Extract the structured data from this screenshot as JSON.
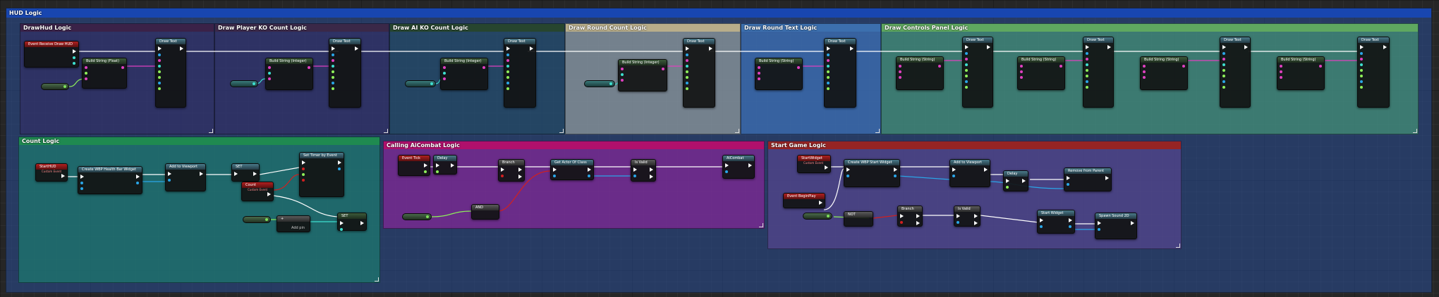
{
  "hud_logic": {
    "title": "HUD Logic"
  },
  "comments": [
    {
      "id": "drawhud",
      "title": "DrawHud Logic",
      "color": "#3a2248"
    },
    {
      "id": "player-ko",
      "title": "Draw Player KO Count Logic",
      "color": "#3a2848"
    },
    {
      "id": "ai-ko",
      "title": "Draw AI KO Count Logic",
      "color": "#27452f"
    },
    {
      "id": "round-count",
      "title": "Draw Round Count Logic",
      "color": "#b8ad8a"
    },
    {
      "id": "round-text",
      "title": "Draw Round Text Logic",
      "color": "#3c6fae"
    },
    {
      "id": "controls",
      "title": "Draw Controls Panel Logic",
      "color": "#5fa860"
    },
    {
      "id": "count",
      "title": "Count Logic",
      "color": "#1f8a50"
    },
    {
      "id": "aicombat",
      "title": "Calling AiCombat Logic",
      "color": "#b0106c"
    },
    {
      "id": "startgame",
      "title": "Start Game Logic",
      "color": "#962424"
    }
  ],
  "nodes": {
    "event_receive_draw_hud": "Event Receive Draw HUD",
    "draw_text": "Draw Text",
    "target_is_hud": "Target is HUD",
    "build_string_float": "Build String (Float)",
    "build_string_integer": "Build String (Integer)",
    "build_string_string": "Build String (String)",
    "start_hud": "StartHUD",
    "custom_event": "Custom Event",
    "create_wbp_health_bar": "Create WBP Health Bar Widget",
    "add_to_viewport": "Add to Viewport",
    "set": "SET",
    "count": "Count",
    "set_timer_by_event": "Set Timer by Event",
    "add_pin": "Add pin",
    "event_tick": "Event Tick",
    "delay": "Delay",
    "branch": "Branch",
    "get_actor_of_class": "Get Actor Of Class",
    "is_valid": "Is Valid",
    "ai_combat": "AiCombat",
    "start_widget_event": "StartWidget",
    "create_wbp_start_widget": "Create WBP Start Widget",
    "event_begin_play": "Event BeginPlay",
    "delay2": "Delay",
    "remove_from_parent": "Remove from Parent",
    "start_widget": "Start Widget",
    "spawn_sound_2d": "Spawn Sound 2D"
  },
  "colors": {
    "exec": "#ffffff",
    "string": "#e040c0",
    "float": "#8ef05a",
    "int": "#3ee0d0",
    "object": "#2aa6e8",
    "bool": "#d02020"
  }
}
